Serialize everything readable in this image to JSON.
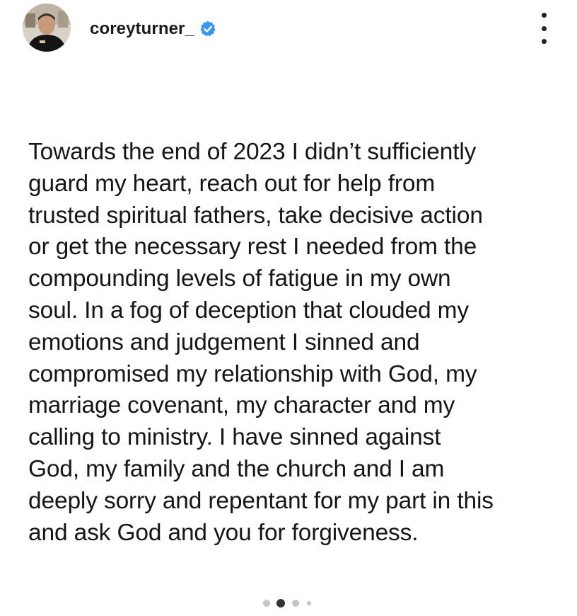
{
  "post": {
    "username": "coreyturner_",
    "verified": true,
    "text": "Towards the end of 2023 I didn’t sufficiently\nguard my heart, reach out for help from\ntrusted spiritual fathers, take decisive action\nor get the necessary rest I needed from the\ncompounding levels of fatigue in my own\nsoul. In a fog of deception that clouded my\nemotions and judgement I sinned and\ncompromised my relationship with God, my\nmarriage covenant, my character and my\ncalling to ministry. I have sinned against\nGod, my family and the church and I am\ndeeply sorry and repentant for my part in this\nand ask God and you for forgiveness.",
    "carousel": {
      "total_dots": 4,
      "active_index": 2
    }
  },
  "icons": {
    "avatar": "profile-photo",
    "verified": "verified-badge-icon",
    "more": "more-options-icon"
  },
  "colors": {
    "verified_blue": "#3897f0",
    "text": "#161616",
    "dot_active": "#333333",
    "dot_inactive": "#c4c4c4"
  }
}
